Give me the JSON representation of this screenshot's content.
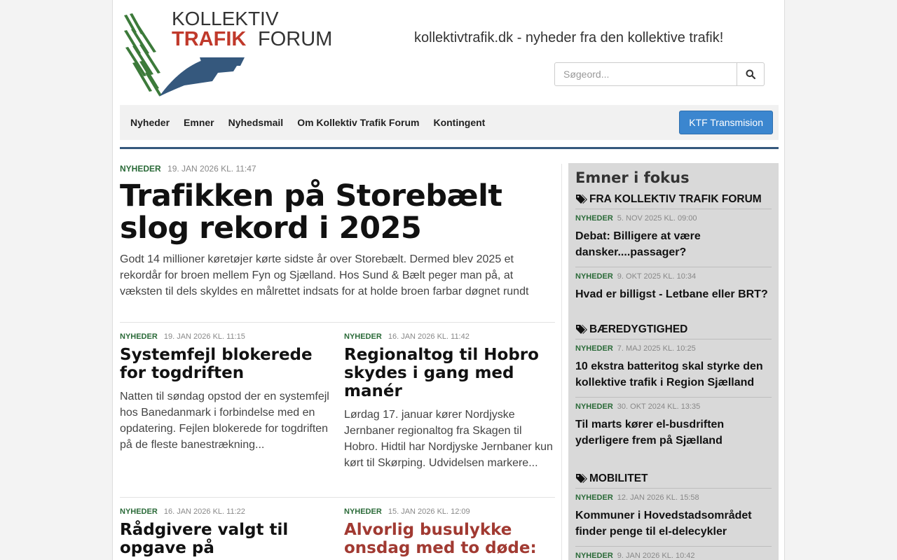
{
  "header": {
    "logo_line1": "KOLLEKTIV",
    "logo_line2a": "TRAFIK",
    "logo_line2b": "FORUM",
    "tagline": "kollektivtrafik.dk - nyheder fra den kollektive trafik!",
    "search": {
      "placeholder": "Søgeord...",
      "icon": "search-icon"
    }
  },
  "nav": {
    "items": [
      "Nyheder",
      "Emner",
      "Nyhedsmail",
      "Om Kollektiv Trafik Forum",
      "Kontingent"
    ],
    "cta": "KTF Transmision"
  },
  "lead": {
    "category": "Nyheder",
    "date": "19. JAN 2026 KL. 11:47",
    "title": "Trafikken på Storebælt slog rekord i 2025",
    "summary": "Godt 14 millioner køretøjer kørte sidste år over Storebælt. Dermed blev 2025 et rekordår for broen mellem Fyn og Sjælland. Hos Sund & Bælt peger man på, at væksten til dels skyldes en målrettet indsats for at holde broen farbar døgnet rundt"
  },
  "articles": [
    {
      "category": "Nyheder",
      "date": "19. JAN 2026 KL. 11:15",
      "title": "Systemfejl blokerede for togdriften",
      "summary": "Natten til søndag opstod der en systemfejl hos Banedanmark i forbindelse med en opdatering. Fejlen blokerede for togdriften på de fleste banestrækning..."
    },
    {
      "category": "Nyheder",
      "date": "16. JAN 2026 KL. 11:42",
      "title": "Regionaltog til Hobro skydes i gang med manér",
      "summary": "Lørdag 17. januar kører Nordjyske Jernbaner regionaltog fra Skagen til Hobro. Hidtil har Nordjyske Jernbaner kun kørt til Skørping. Udvidelsen markere..."
    },
    {
      "category": "Nyheder",
      "date": "16. JAN 2026 KL. 11:22",
      "title": "Rådgivere valgt til opgave på",
      "summary": ""
    },
    {
      "category": "Nyheder",
      "date": "15. JAN 2026 KL. 12:09",
      "title": "Alvorlig busulykke onsdag med to døde:",
      "summary": ""
    }
  ],
  "sidebar": {
    "heading": "Emner i fokus",
    "topics": [
      {
        "name": "Fra Kollektiv Trafik Forum",
        "items": [
          {
            "category": "Nyheder",
            "date": "5. NOV 2025 KL. 09:00",
            "title": "Debat: Billigere at være dansker....passager?"
          },
          {
            "category": "Nyheder",
            "date": "9. OKT 2025 KL. 10:34",
            "title": "Hvad er billigst - Letbane eller BRT?"
          }
        ]
      },
      {
        "name": "Bæredygtighed",
        "items": [
          {
            "category": "Nyheder",
            "date": "7. MAJ 2025 KL. 10:25",
            "title": "10 ekstra batteritog skal styrke den kollektive trafik i Region Sjælland"
          },
          {
            "category": "Nyheder",
            "date": "30. OKT 2024 KL. 13:35",
            "title": "Til marts kører el-busdriften yderligere frem på Sjælland"
          }
        ]
      },
      {
        "name": "Mobilitet",
        "items": [
          {
            "category": "Nyheder",
            "date": "12. JAN 2026 KL. 15:58",
            "title": "Kommuner i Hovedstadsområdet finder penge til el-delecykler"
          },
          {
            "category": "Nyheder",
            "date": "9. JAN 2026 KL. 10:42",
            "title": ""
          }
        ]
      }
    ]
  },
  "colors": {
    "brand_blue": "#35587d",
    "brand_green": "#3c7a3a",
    "logo_red": "#c0392b",
    "accent_button": "#3b86cf",
    "category_green": "#2a6a38",
    "alert_red": "#a13a32"
  }
}
